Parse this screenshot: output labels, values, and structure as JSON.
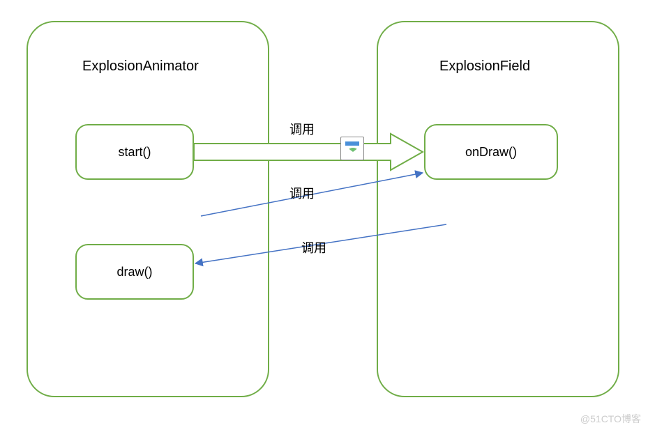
{
  "left_box": {
    "title": "ExplosionAnimator",
    "methods": {
      "start": "start()",
      "draw": "draw()"
    }
  },
  "right_box": {
    "title": "ExplosionField",
    "methods": {
      "onDraw": "onDraw()"
    }
  },
  "labels": {
    "call1": "调用",
    "call2": "调用",
    "call3": "调用"
  },
  "icon": {
    "name": "image-icon"
  },
  "watermark": "@51CTO博客",
  "colors": {
    "border_green": "#70AD47",
    "arrow_blue": "#4472C4"
  }
}
